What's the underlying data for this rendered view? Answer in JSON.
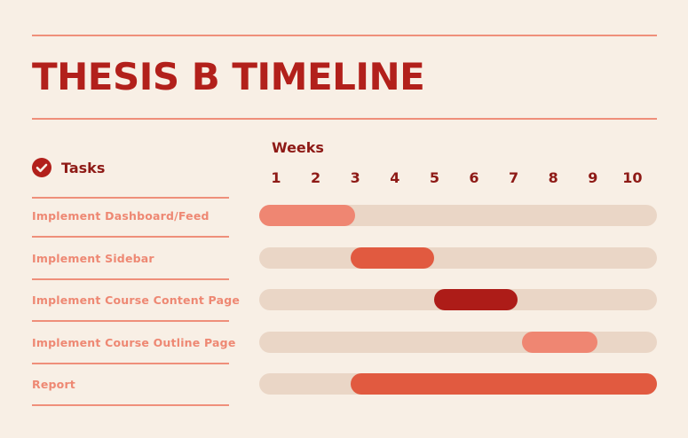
{
  "title": "THESIS B TIMELINE",
  "colors": {
    "background": "#f8efe5",
    "rule": "#ef8f7a",
    "title": "#b2201b",
    "heading": "#8e1a16",
    "task_label": "#ee8873",
    "track": "#ead6c6"
  },
  "icons": {
    "tasks": "check-circle-icon"
  },
  "chart_data": {
    "type": "gantt",
    "xlabel": "Weeks",
    "ylabel": "Tasks",
    "x_ticks": [
      "1",
      "2",
      "3",
      "4",
      "5",
      "6",
      "7",
      "8",
      "9",
      "10"
    ],
    "xlim": [
      1,
      11
    ],
    "tasks": [
      {
        "name": "Implement Dashboard/Feed",
        "start": 1,
        "end": 3.4,
        "color": "#ef8672"
      },
      {
        "name": "Implement Sidebar",
        "start": 3.3,
        "end": 5.4,
        "color": "#e15a40"
      },
      {
        "name": "Implement Course Content Page",
        "start": 5.4,
        "end": 7.5,
        "color": "#ad1c18"
      },
      {
        "name": "Implement Course Outline Page",
        "start": 7.6,
        "end": 9.5,
        "color": "#ef8672"
      },
      {
        "name": "Report",
        "start": 3.3,
        "end": 11,
        "color": "#e15a40"
      }
    ]
  }
}
